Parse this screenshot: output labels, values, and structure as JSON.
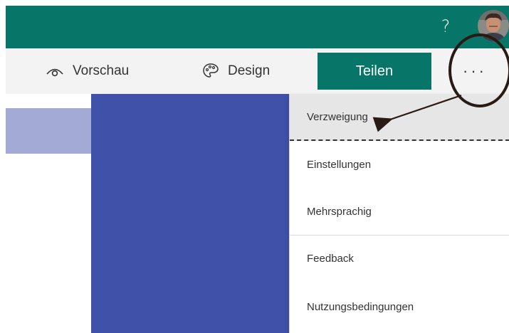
{
  "topbar": {
    "help_label": "?",
    "avatar_alt": "",
    "color": "#077568"
  },
  "toolbar": {
    "preview_label": "Vorschau",
    "preview_icon": "eye-icon",
    "design_label": "Design",
    "design_icon": "palette-icon",
    "share_label": "Teilen",
    "more_label": "···"
  },
  "menu": {
    "items": [
      {
        "label": "Verzweigung"
      },
      {
        "label": "Einstellungen"
      },
      {
        "label": "Mehrsprachig"
      },
      {
        "label": "Feedback"
      },
      {
        "label": "Nutzungsbedingungen"
      }
    ]
  },
  "colors": {
    "accent": "#077568",
    "form_theme": "#3f51a8",
    "form_title_strip": "#a4aad6",
    "annotation": "#2a1a14"
  }
}
